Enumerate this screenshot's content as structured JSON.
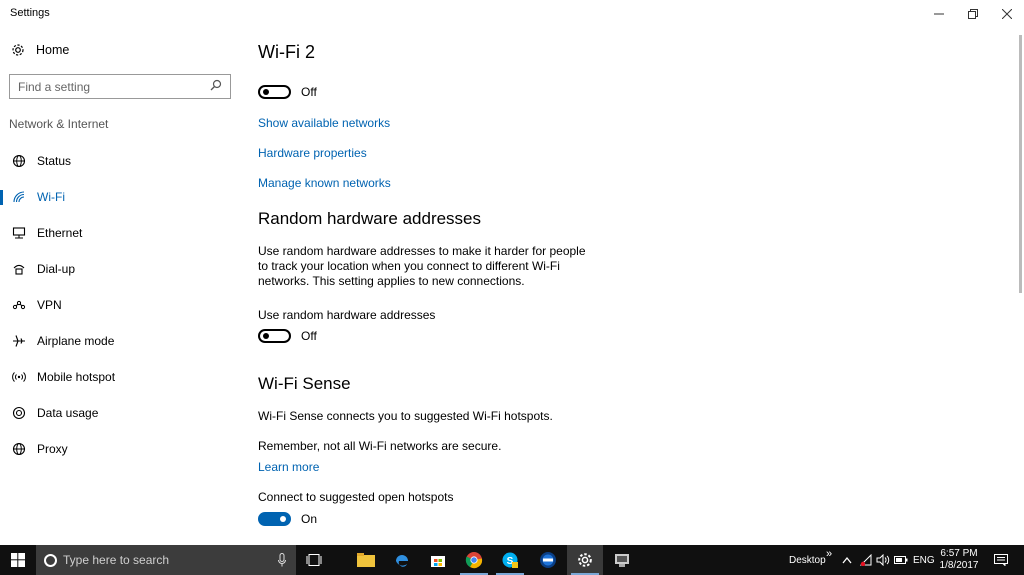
{
  "window": {
    "title": "Settings"
  },
  "sidebar": {
    "home_label": "Home",
    "search_placeholder": "Find a setting",
    "section_label": "Network & Internet",
    "items": [
      {
        "label": "Status",
        "icon": "globe-status-icon"
      },
      {
        "label": "Wi-Fi",
        "icon": "wifi-icon",
        "active": true
      },
      {
        "label": "Ethernet",
        "icon": "ethernet-icon"
      },
      {
        "label": "Dial-up",
        "icon": "dialup-icon"
      },
      {
        "label": "VPN",
        "icon": "vpn-icon"
      },
      {
        "label": "Airplane mode",
        "icon": "airplane-icon"
      },
      {
        "label": "Mobile hotspot",
        "icon": "hotspot-icon"
      },
      {
        "label": "Data usage",
        "icon": "data-usage-icon"
      },
      {
        "label": "Proxy",
        "icon": "globe-icon"
      }
    ]
  },
  "main": {
    "title": "Wi-Fi 2",
    "wifi_toggle": {
      "state": "Off",
      "on": false
    },
    "links": {
      "show_networks": "Show available networks",
      "hardware_properties": "Hardware properties",
      "manage_networks": "Manage known networks"
    },
    "random_hw": {
      "heading": "Random hardware addresses",
      "description": "Use random hardware addresses to make it harder for people to track your location when you connect to different Wi-Fi networks. This setting applies to new connections.",
      "toggle_label": "Use random hardware addresses",
      "toggle_state": "Off"
    },
    "wifi_sense": {
      "heading": "Wi-Fi Sense",
      "description": "Wi-Fi Sense connects you to suggested Wi-Fi hotspots.",
      "warning": "Remember, not all Wi-Fi networks are secure.",
      "learn_more": "Learn more",
      "hotspots_label": "Connect to suggested open hotspots",
      "hotspots_state": "On"
    }
  },
  "taskbar": {
    "search_placeholder": "Type here to search",
    "desktop_label": "Desktop",
    "language": "ENG",
    "time": "6:57 PM",
    "date": "1/8/2017"
  },
  "colors": {
    "accent": "#0063b1",
    "taskbar": "#101010"
  }
}
